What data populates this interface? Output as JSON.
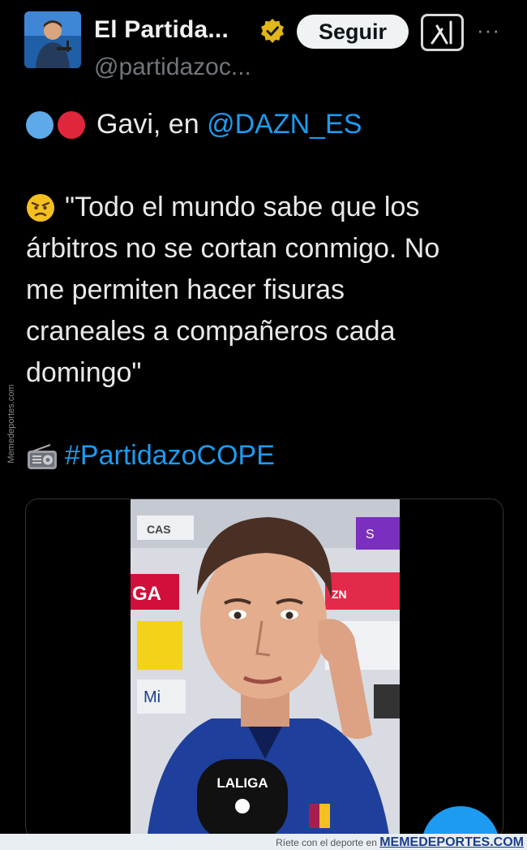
{
  "account": {
    "display_name": "El Partida...",
    "handle": "@partidazoc...",
    "follow_label": "Seguir",
    "more_label": "···"
  },
  "tweet": {
    "line1_prefix": "Gavi, en ",
    "mention": "@DAZN_ES",
    "quote_lines": [
      "\"Todo el mundo sabe que los",
      "árbitros no se cortan conmigo. No",
      "me permiten hacer fisuras",
      "craneales a compañeros cada",
      "domingo\""
    ],
    "hashtag": "#PartidazoCOPE"
  },
  "media": {
    "mic_label": "LALIGA"
  },
  "watermark": {
    "side_text": "Memedeportes.com",
    "footer_text": "Ríete con el deporte en ",
    "footer_brand": "MEMEDEPORTES.COM"
  },
  "colors": {
    "link": "#1d9bf0",
    "verified_gold": "#e2b719",
    "dot_blue": "#5da9ea",
    "dot_red": "#e0263c"
  }
}
